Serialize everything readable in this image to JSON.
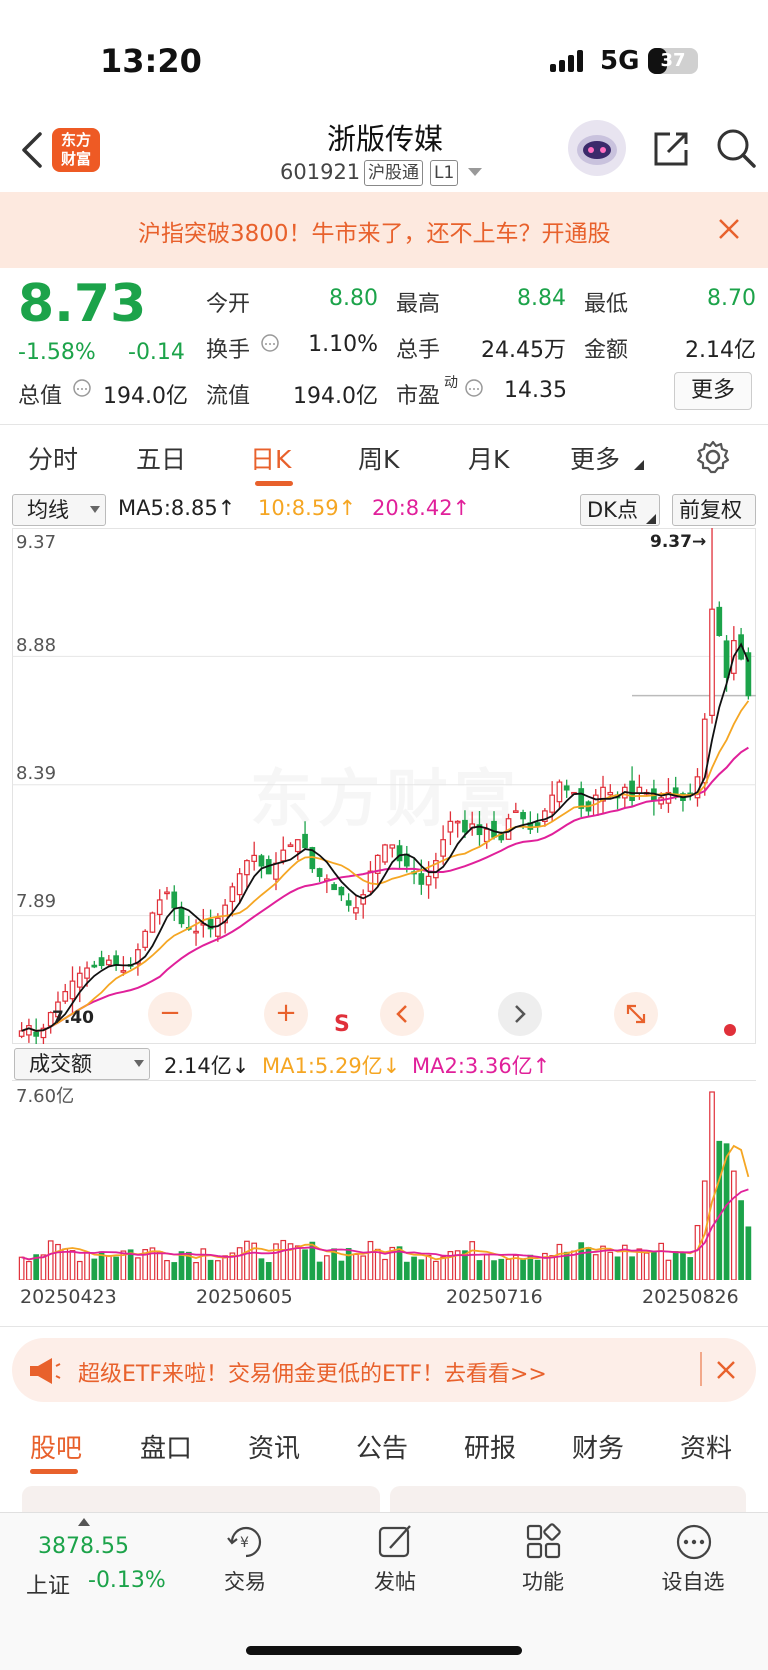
{
  "status_bar": {
    "time": "13:20",
    "network": "5G",
    "battery": "37",
    "battery_level": 0.37
  },
  "header": {
    "logo_text": "东方\n财富",
    "stock_name": "浙版传媒",
    "stock_code": "601921",
    "tags": [
      "沪股通",
      "L1"
    ]
  },
  "banner": {
    "text": "沪指突破3800！牛市来了，还不上车？开通股"
  },
  "quote": {
    "price": "8.73",
    "change_pct": "-1.58%",
    "change": "-0.14",
    "fields": [
      {
        "label": "今开",
        "value": "8.80"
      },
      {
        "label": "最高",
        "value": "8.84"
      },
      {
        "label": "最低",
        "value": "8.70"
      },
      {
        "label": "换手",
        "value": "1.10%"
      },
      {
        "label": "总手",
        "value": "24.45万"
      },
      {
        "label": "金额",
        "value": "2.14亿"
      },
      {
        "label": "总值",
        "value": "194.0亿"
      },
      {
        "label": "流值",
        "value": "194.0亿"
      },
      {
        "label": "市盈",
        "value": "14.35",
        "sup": "动"
      }
    ],
    "more_button": "更多"
  },
  "chart_tabs": [
    "分时",
    "五日",
    "日K",
    "周K",
    "月K",
    "更多"
  ],
  "active_chart_tab": "日K",
  "ma_bar": {
    "indicator": "均线",
    "ma5": "MA5:8.85↑",
    "ma10": "10:8.59↑",
    "ma20": "20:8.42↑",
    "dk_button": "DK点",
    "adjust_button": "前复权"
  },
  "colors": {
    "up": "#e0303a",
    "down": "#1ca34a",
    "ma5": "#111111",
    "ma10": "#f5a623",
    "ma20": "#e0209a",
    "accent": "#e8612c"
  },
  "kline_axis": {
    "labels": [
      "9.37",
      "8.88",
      "8.39",
      "7.89"
    ],
    "high_marker": "9.37→",
    "low_marker": "7.40"
  },
  "chart_controls": {
    "s_label": "S"
  },
  "volume_bar": {
    "indicator": "成交额",
    "current": "2.14亿↓",
    "ma1": "MA1:5.29亿↓",
    "ma2": "MA2:3.36亿↑",
    "max_label": "7.60亿"
  },
  "date_labels": [
    "20250423",
    "20250605",
    "20250716",
    "20250826"
  ],
  "chart_data": {
    "type": "candlestick",
    "ylim": [
      7.4,
      9.37
    ],
    "closes": [
      7.45,
      7.47,
      7.43,
      7.46,
      7.52,
      7.56,
      7.6,
      7.64,
      7.67,
      7.69,
      7.7,
      7.7,
      7.72,
      7.7,
      7.68,
      7.7,
      7.76,
      7.83,
      7.9,
      7.95,
      7.98,
      7.92,
      7.86,
      7.84,
      7.83,
      7.86,
      7.84,
      7.88,
      7.93,
      8.0,
      8.05,
      8.1,
      8.12,
      8.08,
      8.05,
      8.09,
      8.14,
      8.16,
      8.18,
      8.15,
      8.07,
      8.04,
      8.03,
      7.99,
      7.97,
      7.93,
      7.92,
      7.97,
      8.06,
      8.12,
      8.16,
      8.16,
      8.1,
      8.08,
      8.05,
      8.01,
      8.04,
      8.1,
      8.18,
      8.25,
      8.25,
      8.21,
      8.24,
      8.2,
      8.22,
      8.19,
      8.18,
      8.26,
      8.29,
      8.26,
      8.22,
      8.23,
      8.29,
      8.35,
      8.4,
      8.37,
      8.36,
      8.3,
      8.29,
      8.35,
      8.38,
      8.36,
      8.34,
      8.38,
      8.33,
      8.38,
      8.36,
      8.33,
      8.34,
      8.36,
      8.35,
      8.33,
      8.35,
      8.42,
      8.64,
      9.06,
      8.96,
      8.8,
      8.94,
      8.87,
      8.73
    ],
    "volume_unit": "亿",
    "volume_max": 7.6
  },
  "etf_banner": {
    "text": "超级ETF来啦！交易佣金更低的ETF！去看看>>"
  },
  "bottom_tabs": [
    "股吧",
    "盘口",
    "资讯",
    "公告",
    "研报",
    "财务",
    "资料"
  ],
  "active_bottom_tab": "股吧",
  "bottom_nav": {
    "index_value": "3878.55",
    "index_name": "上证",
    "index_change": "-0.13%",
    "items": [
      "交易",
      "发帖",
      "功能",
      "设自选"
    ]
  }
}
